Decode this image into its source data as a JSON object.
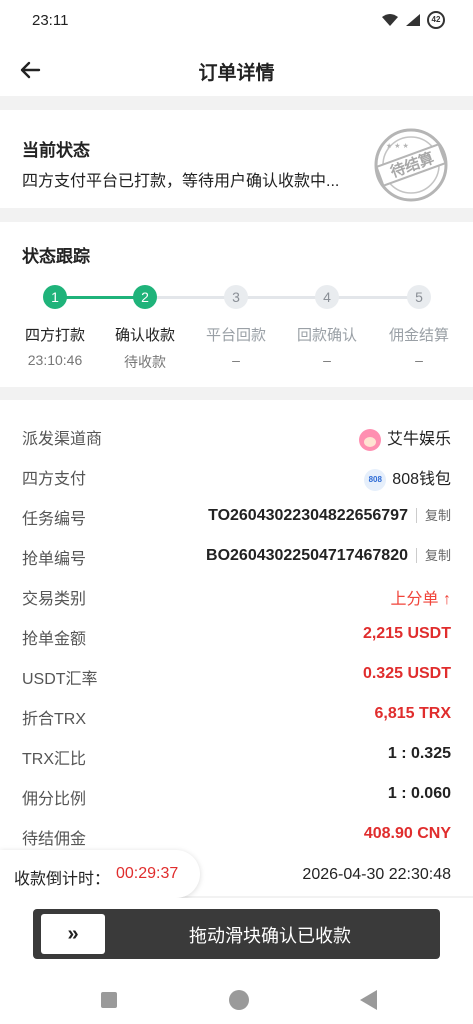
{
  "status_bar": {
    "time": "23:11",
    "battery": "42"
  },
  "header": {
    "title": "订单详情"
  },
  "current_status": {
    "heading": "当前状态",
    "text": "四方支付平台已打款，等待用户确认收款中...",
    "stamp_text": "待结算"
  },
  "tracking": {
    "heading": "状态跟踪",
    "steps": [
      {
        "num": "1",
        "label": "四方打款",
        "sub": "23:10:46",
        "state": "done"
      },
      {
        "num": "2",
        "label": "确认收款",
        "sub": "待收款",
        "state": "done"
      },
      {
        "num": "3",
        "label": "平台回款",
        "sub": "–",
        "state": "todo"
      },
      {
        "num": "4",
        "label": "回款确认",
        "sub": "–",
        "state": "todo"
      },
      {
        "num": "5",
        "label": "佣金结算",
        "sub": "–",
        "state": "todo"
      }
    ]
  },
  "details": {
    "rows": [
      {
        "label": "派发渠道商",
        "value": "艾牛娱乐"
      },
      {
        "label": "四方支付",
        "value": "808钱包",
        "logo_text": "808"
      },
      {
        "label": "任务编号",
        "value": "TO26043022304822656797",
        "action": "复制"
      },
      {
        "label": "抢单编号",
        "value": "BO26043022504717467820",
        "action": "复制"
      },
      {
        "label": "交易类别",
        "value": "上分单 ↑"
      },
      {
        "label": "抢单金额",
        "value": "2,215 USDT"
      },
      {
        "label": "USDT汇率",
        "value": "0.325 USDT"
      },
      {
        "label": "折合TRX",
        "value": "6,815 TRX"
      },
      {
        "label": "TRX汇比",
        "value": "1 : 0.325"
      },
      {
        "label": "佣分比例",
        "value": "1 : 0.060"
      },
      {
        "label": "待结佣金",
        "value": "408.90 CNY"
      }
    ]
  },
  "countdown": {
    "label": "收款倒计时：",
    "value": "00:29:37"
  },
  "datetime": "2026-04-30 22:30:48",
  "slider": {
    "knob": "»",
    "text": "拖动滑块确认已收款"
  },
  "colors": {
    "accent": "#1fb37a",
    "red": "#e02d2d",
    "slider_bg": "#3a3a3a"
  }
}
